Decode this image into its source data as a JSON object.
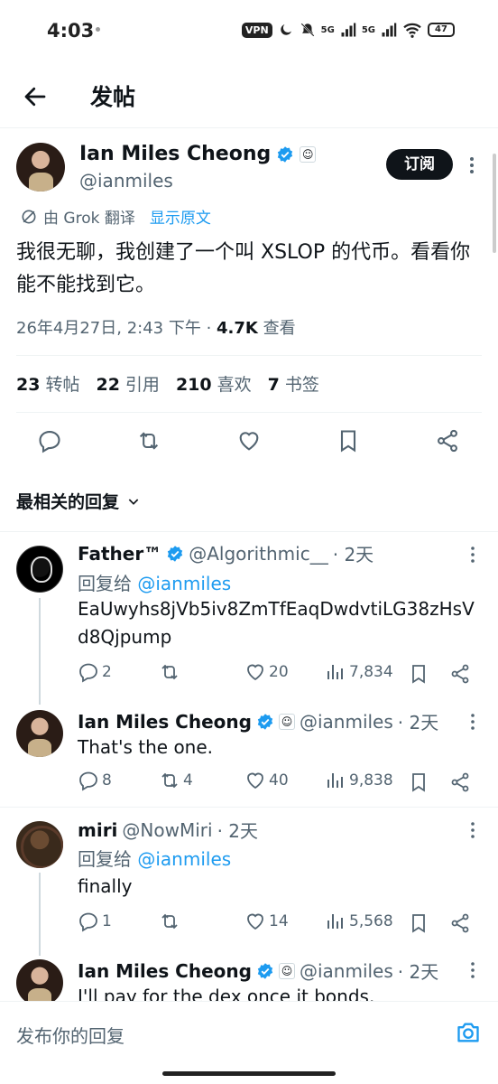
{
  "status_bar": {
    "time": "4:03",
    "vpn": "VPN",
    "net1": "5G",
    "net2": "5G",
    "battery": "47"
  },
  "header": {
    "title": "发帖"
  },
  "main_post": {
    "name": "Ian Miles Cheong",
    "handle": "@ianmiles",
    "subscribe_label": "订阅",
    "grok_label": "由 Grok 翻译",
    "show_original": "显示原文",
    "text": "我很无聊，我创建了一个叫 XSLOP 的代币。看看你能不能找到它。",
    "timestamp": "26年4月27日, 2:43 下午 · ",
    "views": "4.7K",
    "views_label": "查看",
    "counts": [
      {
        "value": "23",
        "label": "转帖"
      },
      {
        "value": "22",
        "label": "引用"
      },
      {
        "value": "210",
        "label": "喜欢"
      },
      {
        "value": "7",
        "label": "书签"
      }
    ]
  },
  "sort": {
    "label": "最相关的回复"
  },
  "replies": [
    {
      "name": "Father™",
      "handle": "@Algorithmic__",
      "time": "· 2天",
      "reply_to_prefix": "回复给",
      "reply_to": "@ianmiles",
      "text": "EaUwyhs8jVb5iv8ZmTfEaqDwdvtiLG38zHsVd8Qjpump",
      "comments": "2",
      "reposts": "",
      "likes": "20",
      "views": "7,834"
    },
    {
      "name": "Ian Miles Cheong",
      "handle": "@ianmiles",
      "time": "· 2天",
      "text": "That's the one.",
      "comments": "8",
      "reposts": "4",
      "likes": "40",
      "views": "9,838"
    },
    {
      "name": "miri",
      "handle": "@NowMiri",
      "time": "· 2天",
      "reply_to_prefix": "回复给",
      "reply_to": "@ianmiles",
      "text": "finally",
      "comments": "1",
      "reposts": "",
      "likes": "14",
      "views": "5,568"
    },
    {
      "name": "Ian Miles Cheong",
      "handle": "@ianmiles",
      "time": "· 2天",
      "text": "I'll pay for the dex once it bonds."
    }
  ],
  "compose": {
    "placeholder": "发布你的回复"
  },
  "colors": {
    "accent": "#1d9bf0",
    "text": "#0f1419",
    "muted": "#536471"
  }
}
